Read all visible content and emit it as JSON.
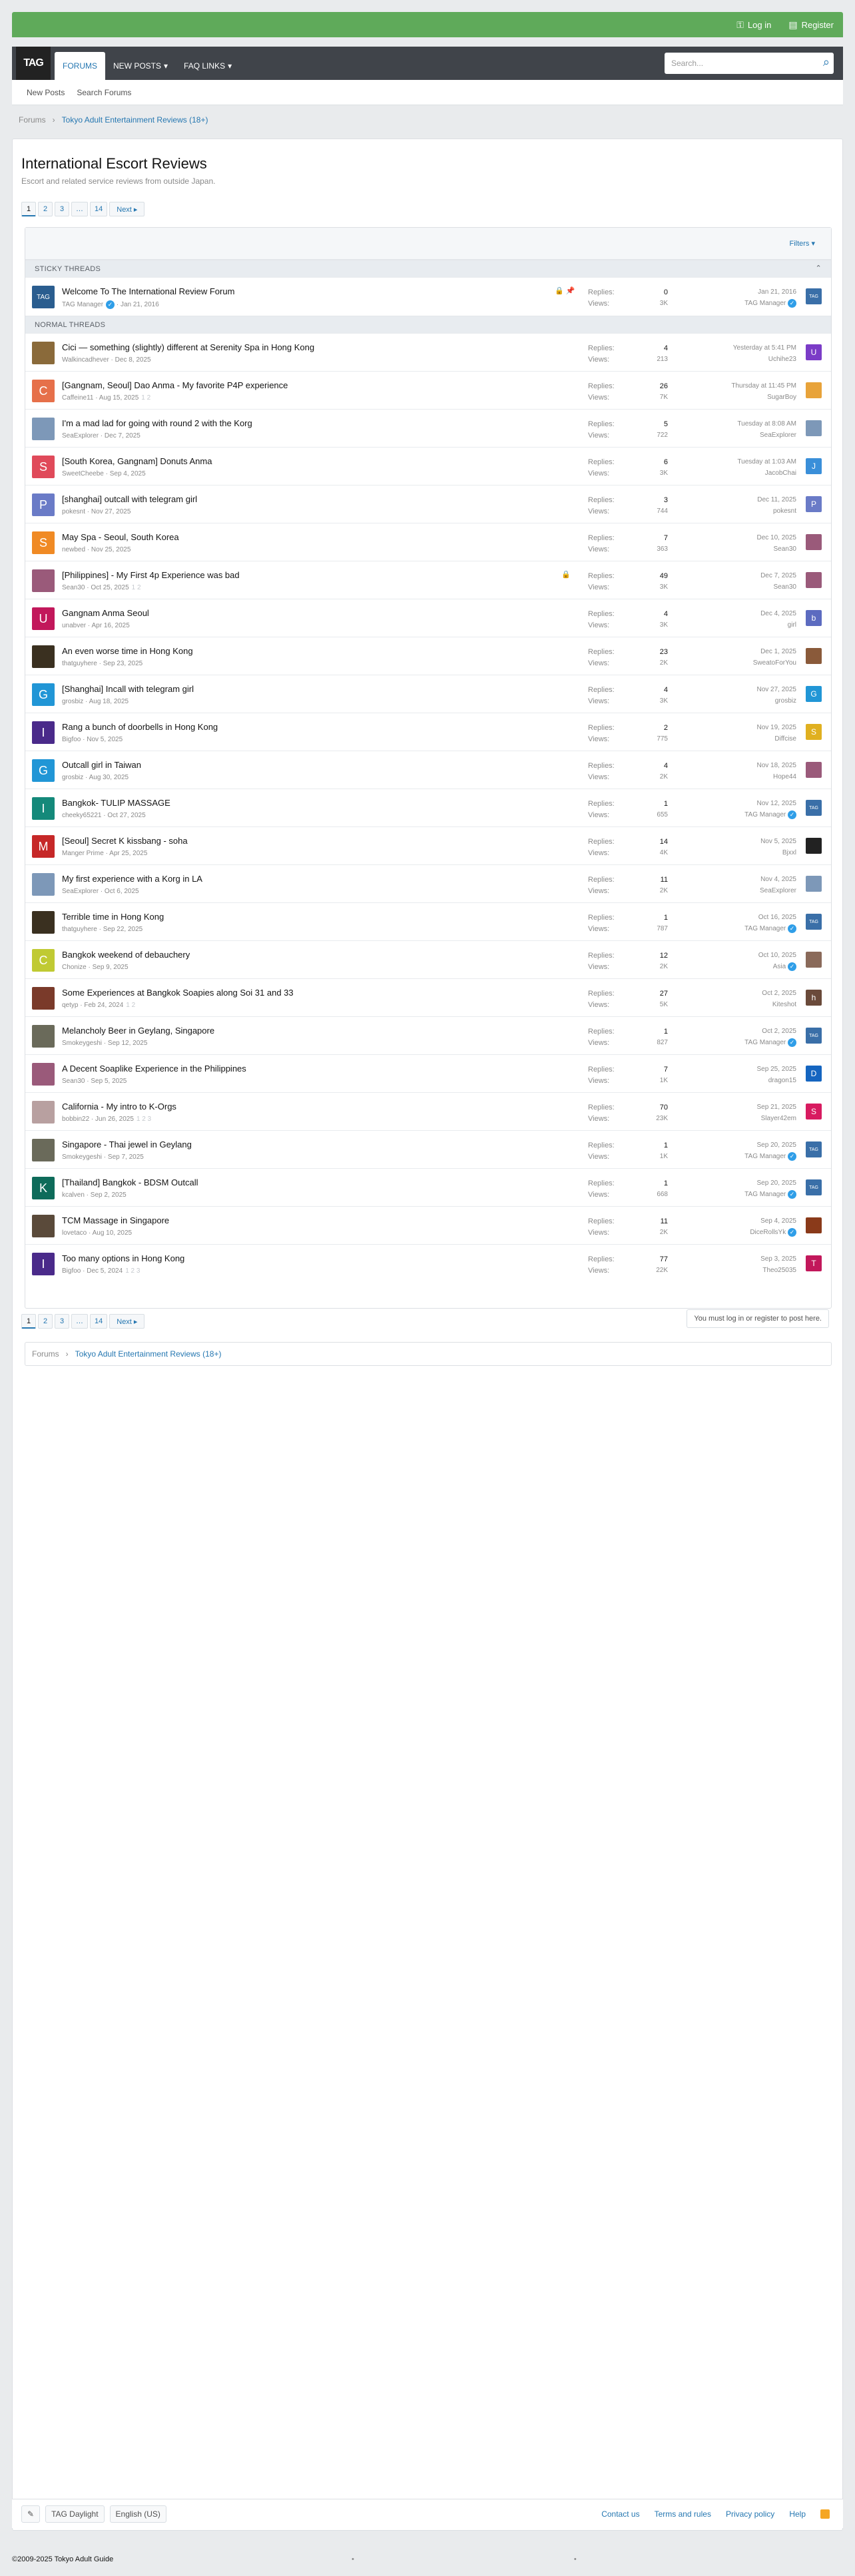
{
  "header": {
    "login": "Log in",
    "register": "Register",
    "logo": "TAG",
    "nav": [
      {
        "label": "FORUMS",
        "active": true,
        "dropdown": false
      },
      {
        "label": "NEW POSTS",
        "active": false,
        "dropdown": true
      },
      {
        "label": "FAQ LINKS",
        "active": false,
        "dropdown": true
      }
    ],
    "search_placeholder": "Search...",
    "subnav": [
      "New Posts",
      "Search Forums"
    ]
  },
  "breadcrumb": [
    "Forums",
    "Tokyo Adult Entertainment Reviews (18+)"
  ],
  "page": {
    "title": "International Escort Reviews",
    "description": "Escort and related service reviews from outside Japan.",
    "pages": [
      "1",
      "2",
      "3",
      "…",
      "14"
    ],
    "next": "Next ▸",
    "filters": "Filters ▾",
    "sticky_label": "STICKY THREADS",
    "normal_label": "NORMAL THREADS",
    "must_login": "You must log in or register to post here."
  },
  "sticky": [
    {
      "title": "Welcome To The International Review Forum",
      "author": "TAG Manager",
      "date": "Jan 21, 2016",
      "replies": "0",
      "views": "3K",
      "last_date": "Jan 21, 2016",
      "last_user": "TAG Manager",
      "color": "#2a5d8f",
      "avatar": "TAG",
      "lcolor": "#3a6fa8",
      "lav": "TAG",
      "verified": true,
      "lverified": true
    }
  ],
  "threads": [
    {
      "title": "Cici — something (slightly) different at Serenity Spa in Hong Kong",
      "author": "Walkincadhever",
      "date": "Dec 8, 2025",
      "replies": "4",
      "views": "213",
      "last_date": "Yesterday at 5:41 PM",
      "last_user": "Uchihe23",
      "color": "#8a6a3a",
      "avatar": "",
      "lcolor": "#7b3cc7",
      "lav": "U"
    },
    {
      "title": "[Gangnam, Seoul] Dao Anma - My favorite P4P experience",
      "author": "Caffeine11",
      "date": "Aug 15, 2025",
      "pages": "1 2",
      "replies": "26",
      "views": "7K",
      "last_date": "Thursday at 11:45 PM",
      "last_user": "SugarBoy",
      "color": "#e6704a",
      "avatar": "C",
      "lcolor": "#e8a33a",
      "lav": ""
    },
    {
      "title": "I'm a mad lad for going with round 2 with the Korg",
      "author": "SeaExplorer",
      "date": "Dec 7, 2025",
      "replies": "5",
      "views": "722",
      "last_date": "Tuesday at 8:08 AM",
      "last_user": "SeaExplorer",
      "color": "#7d98b8",
      "avatar": "",
      "lcolor": "#7d98b8",
      "lav": ""
    },
    {
      "title": "[South Korea, Gangnam] Donuts Anma",
      "author": "SweetCheebe",
      "date": "Sep 4, 2025",
      "replies": "6",
      "views": "3K",
      "last_date": "Tuesday at 1:03 AM",
      "last_user": "JacobChai",
      "color": "#e04a5a",
      "avatar": "S",
      "lcolor": "#3a8fd9",
      "lav": "J"
    },
    {
      "title": "[shanghai] outcall with telegram girl",
      "author": "pokesnt",
      "date": "Nov 27, 2025",
      "replies": "3",
      "views": "744",
      "last_date": "Dec 11, 2025",
      "last_user": "pokesnt",
      "color": "#6a7bc7",
      "avatar": "P",
      "lcolor": "#6a7bc7",
      "lav": "P"
    },
    {
      "title": "May Spa - Seoul, South Korea",
      "author": "newbed",
      "date": "Nov 25, 2025",
      "replies": "7",
      "views": "363",
      "last_date": "Dec 10, 2025",
      "last_user": "Sean30",
      "color": "#f08a24",
      "avatar": "S",
      "lcolor": "#9a5a7a",
      "lav": ""
    },
    {
      "title": "[Philippines] - My First 4p Experience was bad",
      "author": "Sean30",
      "date": "Oct 25, 2025",
      "pages": "1 2",
      "replies": "49",
      "views": "3K",
      "last_date": "Dec 7, 2025",
      "last_user": "Sean30",
      "color": "#9a5a7a",
      "avatar": "",
      "lcolor": "#9a5a7a",
      "lav": "",
      "locked": true
    },
    {
      "title": "Gangnam Anma Seoul",
      "author": "unabver",
      "date": "Apr 16, 2025",
      "replies": "4",
      "views": "3K",
      "last_date": "Dec 4, 2025",
      "last_user": "girl",
      "color": "#c2185b",
      "avatar": "U",
      "lcolor": "#5c6bc0",
      "lav": "b"
    },
    {
      "title": "An even worse time in Hong Kong",
      "author": "thatguyhere",
      "date": "Sep 23, 2025",
      "replies": "23",
      "views": "2K",
      "last_date": "Dec 1, 2025",
      "last_user": "SweatoForYou",
      "color": "#3a3020",
      "avatar": "",
      "lcolor": "#8a5a3a",
      "lav": ""
    },
    {
      "title": "[Shanghai] Incall with telegram girl",
      "author": "grosbiz",
      "date": "Aug 18, 2025",
      "replies": "4",
      "views": "3K",
      "last_date": "Nov 27, 2025",
      "last_user": "grosbiz",
      "color": "#2196d6",
      "avatar": "G",
      "lcolor": "#2196d6",
      "lav": "G"
    },
    {
      "title": "Rang a bunch of doorbells in Hong Kong",
      "author": "Bigfoo",
      "date": "Nov 5, 2025",
      "replies": "2",
      "views": "775",
      "last_date": "Nov 19, 2025",
      "last_user": "Diffcise",
      "color": "#4a2a8a",
      "avatar": "I",
      "lcolor": "#e0b020",
      "lav": "S"
    },
    {
      "title": "Outcall girl in Taiwan",
      "author": "grosbiz",
      "date": "Aug 30, 2025",
      "replies": "4",
      "views": "2K",
      "last_date": "Nov 18, 2025",
      "last_user": "Hope44",
      "color": "#2196d6",
      "avatar": "G",
      "lcolor": "#9a5a7a",
      "lav": ""
    },
    {
      "title": "Bangkok- TULIP MASSAGE",
      "author": "cheeky65221",
      "date": "Oct 27, 2025",
      "replies": "1",
      "views": "655",
      "last_date": "Nov 12, 2025",
      "last_user": "TAG Manager",
      "color": "#14897a",
      "avatar": "I",
      "lcolor": "#3a6fa8",
      "lav": "TAG",
      "lverified": true
    },
    {
      "title": "[Seoul] Secret K kissbang - soha",
      "author": "Manger Prime",
      "date": "Apr 25, 2025",
      "replies": "14",
      "views": "4K",
      "last_date": "Nov 5, 2025",
      "last_user": "Bjxxl",
      "color": "#c62828",
      "avatar": "M",
      "lcolor": "#222222",
      "lav": ""
    },
    {
      "title": "My first experience with a Korg in LA",
      "author": "SeaExplorer",
      "date": "Oct 6, 2025",
      "replies": "11",
      "views": "2K",
      "last_date": "Nov 4, 2025",
      "last_user": "SeaExplorer",
      "color": "#7d98b8",
      "avatar": "",
      "lcolor": "#7d98b8",
      "lav": ""
    },
    {
      "title": "Terrible time in Hong Kong",
      "author": "thatguyhere",
      "date": "Sep 22, 2025",
      "replies": "1",
      "views": "787",
      "last_date": "Oct 16, 2025",
      "last_user": "TAG Manager",
      "color": "#3a3020",
      "avatar": "",
      "lcolor": "#3a6fa8",
      "lav": "TAG",
      "lverified": true
    },
    {
      "title": "Bangkok weekend of debauchery",
      "author": "Chonize",
      "date": "Sep 9, 2025",
      "replies": "12",
      "views": "2K",
      "last_date": "Oct 10, 2025",
      "last_user": "Asia",
      "color": "#c0ca33",
      "avatar": "C",
      "lcolor": "#8a6a5a",
      "lav": "",
      "lverified": true
    },
    {
      "title": "Some Experiences at Bangkok Soapies along Soi 31 and 33",
      "author": "qetyp",
      "date": "Feb 24, 2024",
      "pages": "1 2",
      "replies": "27",
      "views": "5K",
      "last_date": "Oct 2, 2025",
      "last_user": "Kiteshot",
      "color": "#7a3a2a",
      "avatar": "",
      "lcolor": "#6a4a3a",
      "lav": "h"
    },
    {
      "title": "Melancholy Beer in Geylang, Singapore",
      "author": "Smokeygeshi",
      "date": "Sep 12, 2025",
      "replies": "1",
      "views": "827",
      "last_date": "Oct 2, 2025",
      "last_user": "TAG Manager",
      "color": "#6a6a5a",
      "avatar": "",
      "lcolor": "#3a6fa8",
      "lav": "TAG",
      "lverified": true
    },
    {
      "title": "A Decent Soaplike Experience in the Philippines",
      "author": "Sean30",
      "date": "Sep 5, 2025",
      "replies": "7",
      "views": "1K",
      "last_date": "Sep 25, 2025",
      "last_user": "dragon15",
      "color": "#9a5a7a",
      "avatar": "",
      "lcolor": "#1565c0",
      "lav": "D"
    },
    {
      "title": "California - My intro to K-Orgs",
      "author": "bobbin22",
      "date": "Jun 26, 2025",
      "pages": "1 2 3",
      "replies": "70",
      "views": "23K",
      "last_date": "Sep 21, 2025",
      "last_user": "Slayer42em",
      "color": "#b8a0a0",
      "avatar": "",
      "lcolor": "#d81b60",
      "lav": "S"
    },
    {
      "title": "Singapore - Thai jewel in Geylang",
      "author": "Smokeygeshi",
      "date": "Sep 7, 2025",
      "replies": "1",
      "views": "1K",
      "last_date": "Sep 20, 2025",
      "last_user": "TAG Manager",
      "color": "#6a6a5a",
      "avatar": "",
      "lcolor": "#3a6fa8",
      "lav": "TAG",
      "lverified": true
    },
    {
      "title": "[Thailand] Bangkok - BDSM Outcall",
      "author": "kcalven",
      "date": "Sep 2, 2025",
      "replies": "1",
      "views": "668",
      "last_date": "Sep 20, 2025",
      "last_user": "TAG Manager",
      "color": "#0e6b5a",
      "avatar": "K",
      "lcolor": "#3a6fa8",
      "lav": "TAG",
      "lverified": true
    },
    {
      "title": "TCM Massage in Singapore",
      "author": "lovetaco",
      "date": "Aug 10, 2025",
      "replies": "11",
      "views": "2K",
      "last_date": "Sep 4, 2025",
      "last_user": "DiceRollsYk",
      "color": "#5a4a3a",
      "avatar": "",
      "lcolor": "#8a3a1a",
      "lav": "",
      "lverified": true
    },
    {
      "title": "Too many options in Hong Kong",
      "author": "Bigfoo",
      "date": "Dec 5, 2024",
      "pages": "1 2 3",
      "replies": "77",
      "views": "22K",
      "last_date": "Sep 3, 2025",
      "last_user": "Theo25035",
      "color": "#4a2a8a",
      "avatar": "I",
      "lcolor": "#c2185b",
      "lav": "T"
    }
  ],
  "footer": {
    "style": "TAG Daylight",
    "language": "English (US)",
    "links": [
      "Contact us",
      "Terms and rules",
      "Privacy policy",
      "Help"
    ],
    "copyright": "©2009-2025 Tokyo Adult Guide"
  }
}
